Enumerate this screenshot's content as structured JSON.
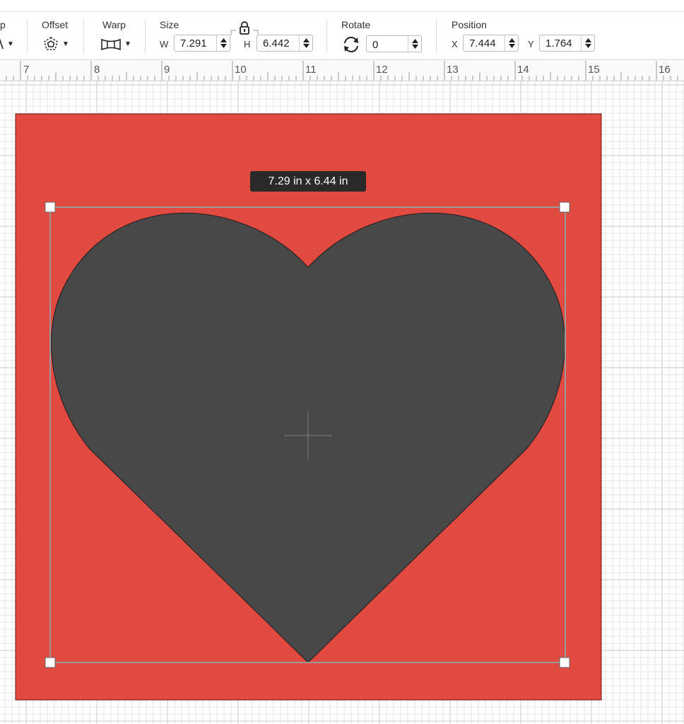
{
  "toolbar": {
    "group_clipped": {
      "label": "p"
    },
    "offset": {
      "label": "Offset",
      "icon": "offset-icon"
    },
    "warp": {
      "label": "Warp",
      "icon": "warp-icon"
    },
    "size": {
      "label": "Size",
      "w_label": "W",
      "w_value": "7.291",
      "h_label": "H",
      "h_value": "6.442",
      "lock_icon": "lock-icon"
    },
    "rotate": {
      "label": "Rotate",
      "value": "0",
      "icon": "rotate-icon"
    },
    "position": {
      "label": "Position",
      "x_label": "X",
      "x_value": "7.444",
      "y_label": "Y",
      "y_value": "1.764"
    }
  },
  "ruler": {
    "labels": [
      "7",
      "8",
      "9",
      "10",
      "11",
      "12",
      "13",
      "14",
      "15",
      "16"
    ]
  },
  "canvas": {
    "tooltip": "7.29  in x 6.44  in",
    "background_shape_color": "#e04a40",
    "heart_color": "#484848",
    "selected_shape_icon": "heart-icon"
  }
}
